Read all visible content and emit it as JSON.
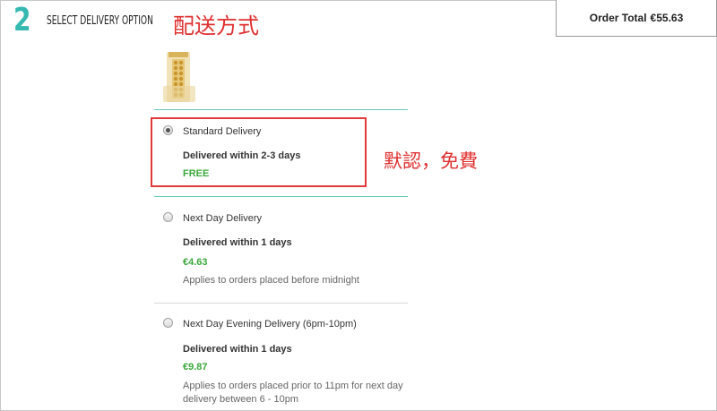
{
  "header": {
    "step_number": "2",
    "step_title": "SELECT DELIVERY OPTION",
    "annotation_title": "配送方式"
  },
  "order_total": {
    "label": "Order Total",
    "amount": "€55.63"
  },
  "annotation_side": "默認，免費",
  "colors": {
    "teal": "#36b9b0",
    "price_green": "#3aa83a",
    "annotation_red": "#e03030"
  },
  "delivery_options": [
    {
      "name": "Standard Delivery",
      "within": "Delivered within 2-3 days",
      "price": "FREE",
      "note": "",
      "selected": true
    },
    {
      "name": "Next Day Delivery",
      "within": "Delivered within 1 days",
      "price": "€4.63",
      "note": "Applies to orders placed before midnight",
      "selected": false
    },
    {
      "name": "Next Day Evening Delivery (6pm-10pm)",
      "within": "Delivered within 1 days",
      "price": "€9.87",
      "note": "Applies to orders placed prior to 11pm for next day delivery between 6 - 10pm",
      "selected": false
    }
  ]
}
